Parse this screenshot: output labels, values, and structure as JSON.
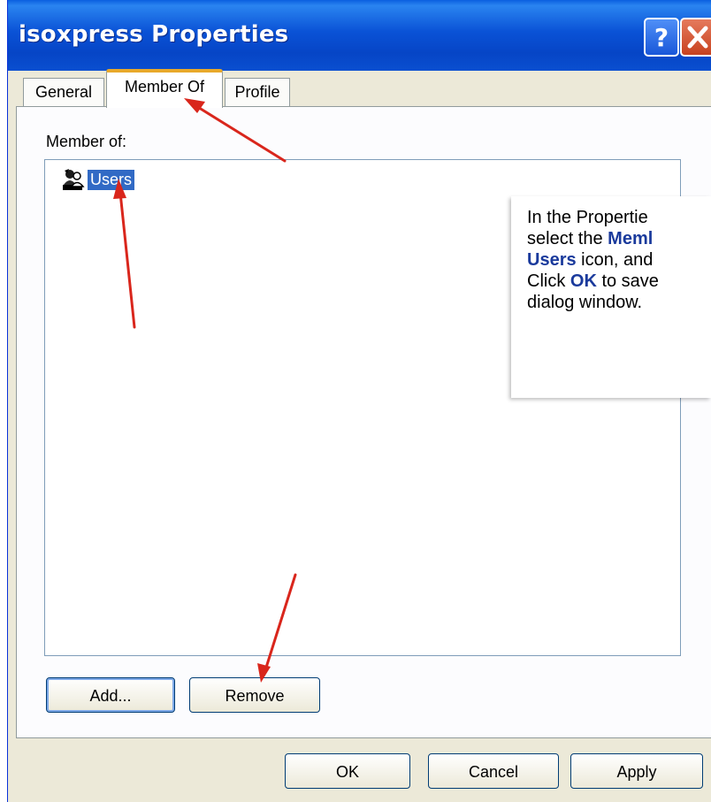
{
  "window": {
    "title": "isoxpress Properties",
    "help_icon": "question-mark-icon",
    "close_icon": "close-x-icon"
  },
  "tabs": [
    {
      "label": "General",
      "selected": false
    },
    {
      "label": "Member Of",
      "selected": true
    },
    {
      "label": "Profile",
      "selected": false
    }
  ],
  "member_of": {
    "label": "Member of:",
    "items": [
      {
        "label": "Users",
        "icon": "group-users-icon",
        "selected": true
      }
    ]
  },
  "buttons": {
    "add": "Add...",
    "remove": "Remove",
    "ok": "OK",
    "cancel": "Cancel",
    "apply": "Apply"
  },
  "callout": {
    "line1": "In the Propertie",
    "line2_prefix": "select the ",
    "line2_bold": "Meml",
    "line3_bold": "Users",
    "line3_suffix": " icon, and",
    "line4_prefix": "Click ",
    "line4_bold": "OK",
    "line4_suffix": " to save",
    "line5": "dialog window."
  },
  "colors": {
    "titlebar": "#0a52d6",
    "selection": "#316ac5",
    "active_tab_accent": "#e8a92a",
    "arrow": "#d9261c",
    "callout_highlight": "#1a3a9c"
  }
}
